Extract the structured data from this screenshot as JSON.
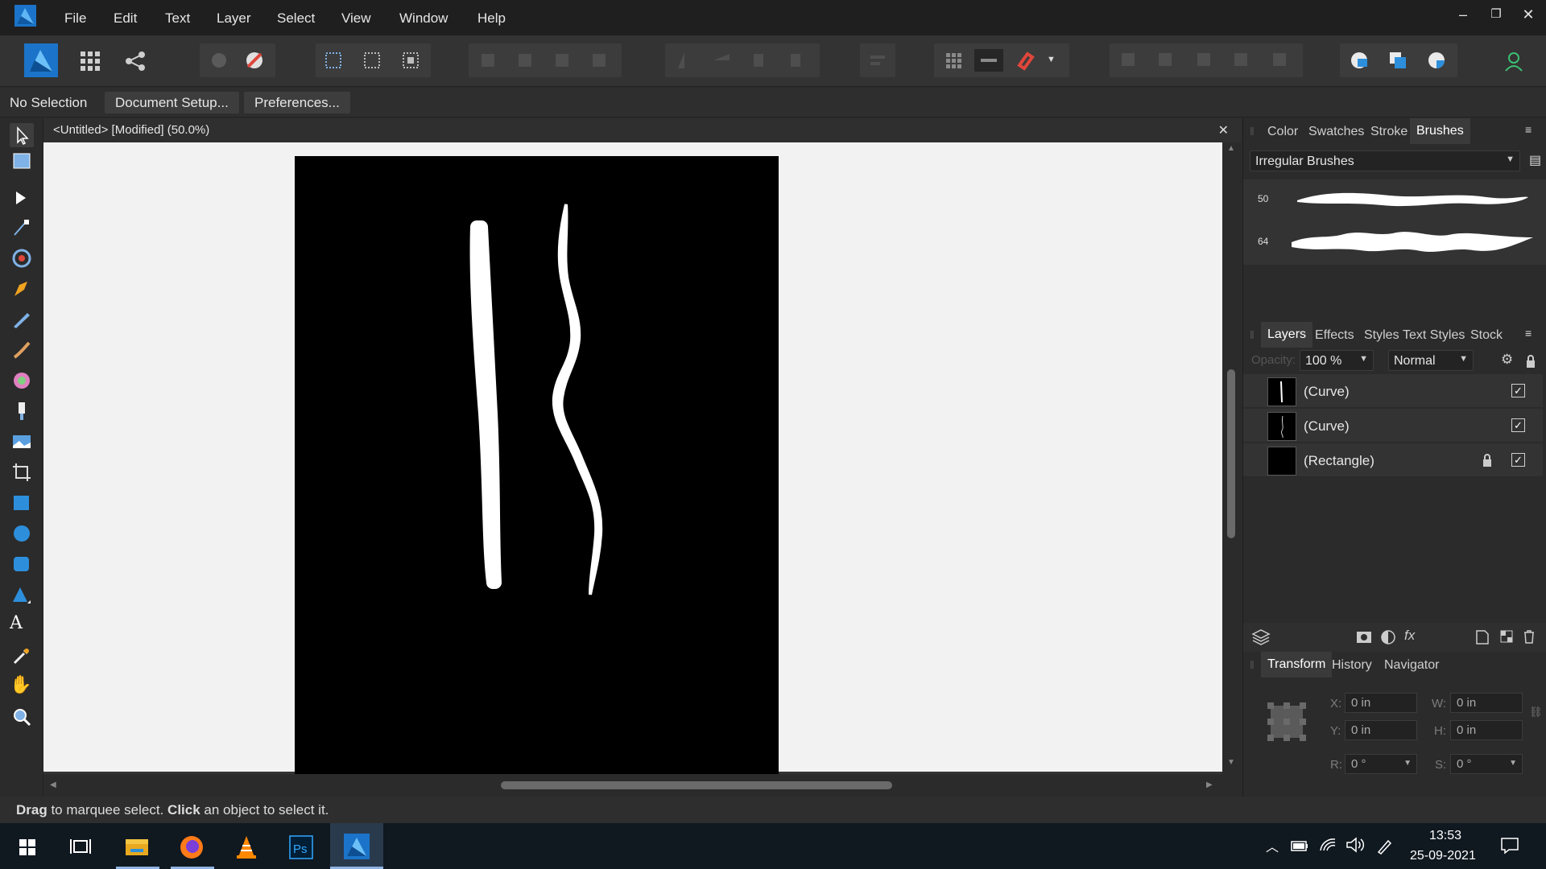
{
  "menu": {
    "items": [
      "File",
      "Edit",
      "Text",
      "Layer",
      "Select",
      "View",
      "Window",
      "Help"
    ]
  },
  "context_bar": {
    "selection": "No Selection",
    "document_setup": "Document Setup...",
    "preferences": "Preferences..."
  },
  "document": {
    "tab_title": "<Untitled> [Modified] (50.0%)"
  },
  "brushes_panel": {
    "tabs": [
      "Color",
      "Swatches",
      "Stroke",
      "Brushes"
    ],
    "active_tab": "Brushes",
    "category": "Irregular Brushes",
    "brushes": [
      {
        "size": "50"
      },
      {
        "size": "64"
      }
    ]
  },
  "layers_panel": {
    "tabs": [
      "Layers",
      "Effects",
      "Styles",
      "Text Styles",
      "Stock"
    ],
    "active_tab": "Layers",
    "opacity_label": "Opacity:",
    "opacity_value": "100 %",
    "blend_mode": "Normal",
    "layers": [
      {
        "name": "(Curve)",
        "visible": true,
        "locked": false
      },
      {
        "name": "(Curve)",
        "visible": true,
        "locked": false
      },
      {
        "name": "(Rectangle)",
        "visible": true,
        "locked": true
      }
    ]
  },
  "transform_panel": {
    "tabs": [
      "Transform",
      "History",
      "Navigator"
    ],
    "active_tab": "Transform",
    "fields": {
      "x_label": "X:",
      "x": "0 in",
      "y_label": "Y:",
      "y": "0 in",
      "w_label": "W:",
      "w": "0 in",
      "h_label": "H:",
      "h": "0 in",
      "r_label": "R:",
      "r": "0 °",
      "s_label": "S:",
      "s": "0 °"
    }
  },
  "status_bar": {
    "drag_bold": "Drag",
    "drag_text": " to marquee select. ",
    "click_bold": "Click",
    "click_text": " an object to select it."
  },
  "taskbar": {
    "time": "13:53",
    "date": "25-09-2021"
  },
  "colors": {
    "accent_blue": "#2d8fdc",
    "canvas": "#f2f2f2",
    "artboard": "#000000"
  }
}
